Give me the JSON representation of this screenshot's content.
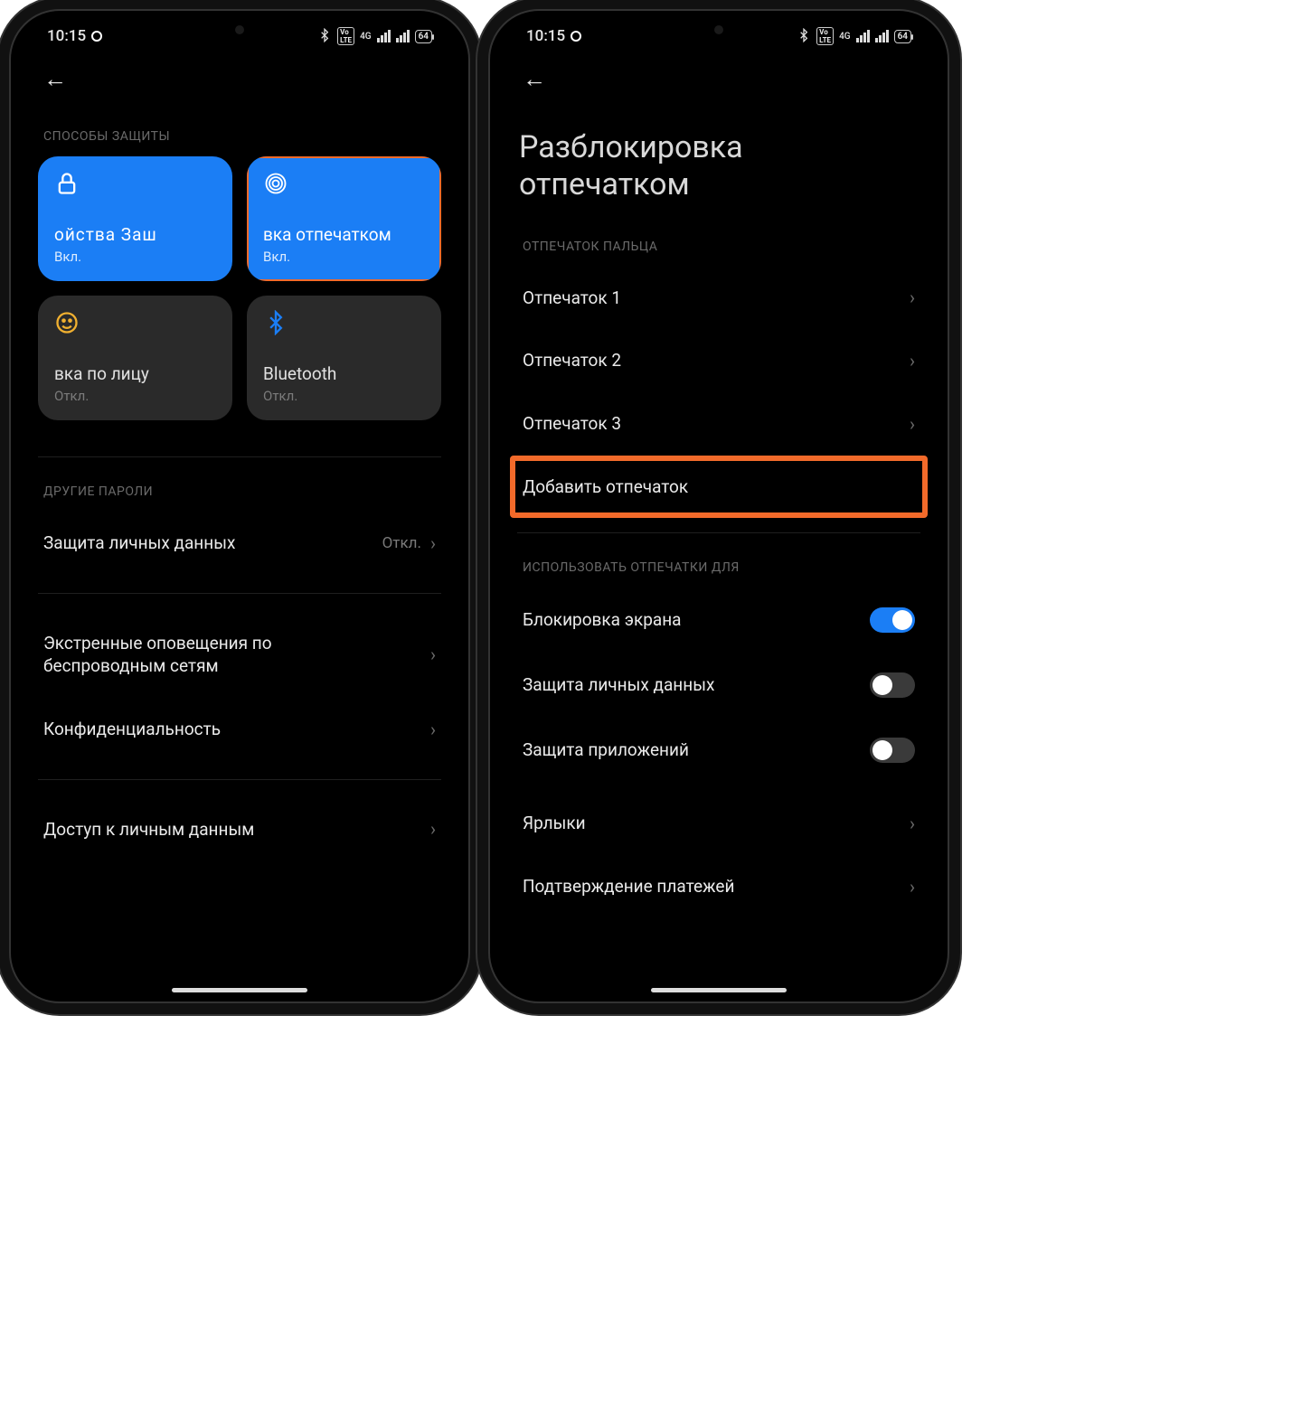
{
  "status": {
    "time": "10:15",
    "battery": "64",
    "net": "4G"
  },
  "left": {
    "section1": "СПОСОБЫ ЗАЩИТЫ",
    "cards": [
      {
        "title": "ойства       Заш",
        "status": "Вкл."
      },
      {
        "title": "вка отпечатком",
        "status": "Вкл."
      },
      {
        "title": "вка по лицу",
        "status": "Откл."
      },
      {
        "title": "Bluetooth",
        "status": "Откл."
      }
    ],
    "section2": "ДРУГИЕ ПАРОЛИ",
    "rows": [
      {
        "label": "Защита личных данных",
        "sub": "Откл."
      },
      {
        "label": "Экстренные оповещения по беспроводным сетям",
        "sub": ""
      },
      {
        "label": "Конфиденциальность",
        "sub": ""
      },
      {
        "label": "Доступ к личным данным",
        "sub": ""
      }
    ]
  },
  "right": {
    "title": "Разблокировка отпечатком",
    "section1": "ОТПЕЧАТОК ПАЛЬЦА",
    "fingerprints": [
      "Отпечаток 1",
      "Отпечаток 2",
      "Отпечаток 3"
    ],
    "add": "Добавить отпечаток",
    "section2": "ИСПОЛЬЗОВАТЬ ОТПЕЧАТКИ ДЛЯ",
    "toggles": [
      {
        "label": "Блокировка экрана",
        "on": true
      },
      {
        "label": "Защита личных данных",
        "on": false
      },
      {
        "label": "Защита приложений",
        "on": false
      }
    ],
    "rows2": [
      "Ярлыки",
      "Подтверждение платежей"
    ]
  },
  "colors": {
    "highlight": "#f26a2a",
    "accent": "#1b7ef5"
  }
}
